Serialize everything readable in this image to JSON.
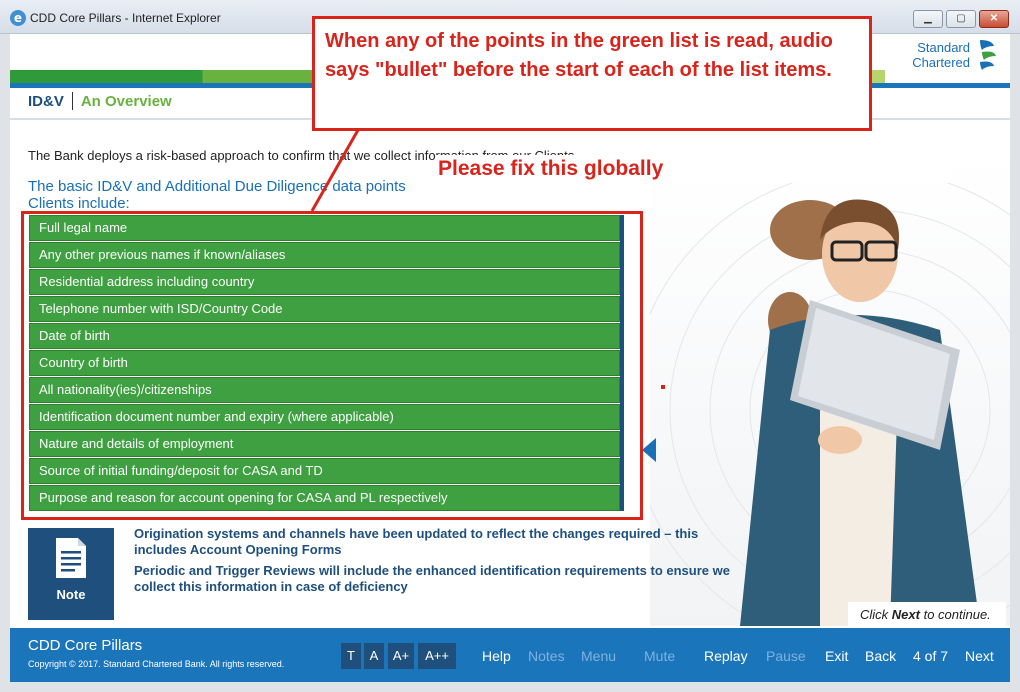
{
  "window": {
    "title": "CDD Core Pillars - Internet Explorer",
    "controls": {
      "minimize": "▁",
      "maximize": "▢",
      "close": "✕"
    },
    "app_icon": "ie-icon"
  },
  "brand": {
    "line1": "Standard",
    "line2": "Chartered",
    "logo_icon": "standard-chartered-logo"
  },
  "breadcrumb": {
    "section": "ID&V",
    "topic": "An Overview"
  },
  "content": {
    "intro": "The Bank deploys a risk-based approach to confirm that we collect information from our Clients.",
    "subheading_line1": "The basic ID&V and Additional Due Diligence data points",
    "subheading_line2": "Clients include:",
    "list": [
      "Full legal name",
      "Any other previous names if known/aliases",
      "Residential address including country",
      "Telephone number with ISD/Country Code",
      "Date of birth",
      "Country of birth",
      "All nationality(ies)/citizenships",
      "Identification document number and expiry (where applicable)",
      "Nature and details of employment",
      "Source of initial funding/deposit for CASA and TD",
      "Purpose and reason for account opening for CASA and PL respectively"
    ]
  },
  "note": {
    "label": "Note",
    "icon": "document-icon",
    "para1": "Origination systems and channels have been updated to reflect the changes required – this includes Account Opening Forms",
    "para2": "Periodic and Trigger Reviews will include the enhanced identification requirements to ensure we collect this information in case of deficiency"
  },
  "continue": {
    "prefix": "Click ",
    "bold": "Next",
    "suffix": " to continue."
  },
  "footer": {
    "course": "CDD Core Pillars",
    "copyright": "Copyright © 2017. Standard Chartered Bank. All rights reserved.",
    "text_sizes": [
      "T",
      "A",
      "A+",
      "A++"
    ],
    "nav": {
      "help": "Help",
      "notes": "Notes",
      "menu": "Menu",
      "mute": "Mute",
      "replay": "Replay",
      "pause": "Pause",
      "exit": "Exit",
      "back": "Back",
      "page": "4 of 7",
      "next": "Next"
    }
  },
  "annotation": {
    "callout": "When any of the points in the green list is read, audio says \"bullet\" before the start of each of the list items.",
    "fix": "Please fix this globally",
    "color": "#d9241c"
  },
  "colors": {
    "accent_blue": "#1b75bb",
    "navy": "#1e4f7d",
    "list_green": "#3ea040",
    "brand_green": "#6ab23f"
  }
}
